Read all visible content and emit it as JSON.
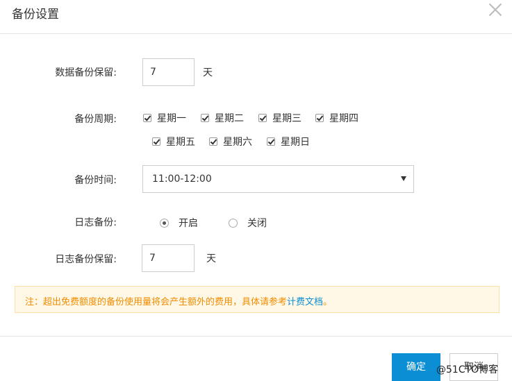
{
  "dialog": {
    "title": "备份设置"
  },
  "retention": {
    "label": "数据备份保留:",
    "value": "7",
    "unit": "天"
  },
  "cycle": {
    "label": "备份周期:",
    "days": [
      {
        "label": "星期一",
        "checked": true
      },
      {
        "label": "星期二",
        "checked": true
      },
      {
        "label": "星期三",
        "checked": true
      },
      {
        "label": "星期四",
        "checked": true
      },
      {
        "label": "星期五",
        "checked": true
      },
      {
        "label": "星期六",
        "checked": true
      },
      {
        "label": "星期日",
        "checked": true
      }
    ]
  },
  "time": {
    "label": "备份时间:",
    "selected": "11:00-12:00"
  },
  "log_backup": {
    "label": "日志备份:",
    "options": [
      {
        "label": "开启",
        "checked": true
      },
      {
        "label": "关闭",
        "checked": false
      }
    ]
  },
  "log_retention": {
    "label": "日志备份保留:",
    "value": "7",
    "unit": "天"
  },
  "notice": {
    "text": "注：超出免费额度的备份使用量将会产生额外的费用，具体请参考",
    "link": "计费文档",
    "suffix": "。"
  },
  "footer": {
    "ok": "确定",
    "cancel": "取消"
  },
  "watermark": "@51CTO博客"
}
